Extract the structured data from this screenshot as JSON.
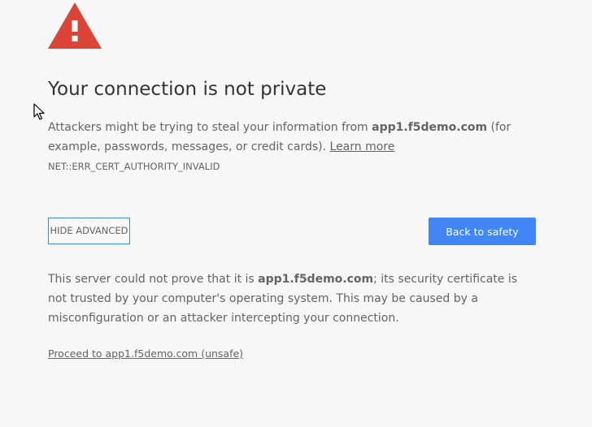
{
  "interstitial": {
    "title": "Your connection is not private",
    "main_prefix": "Attackers might be trying to steal your information from ",
    "domain": "app1.f5demo.com",
    "main_suffix": " (for example, passwords, messages, or credit cards). ",
    "learn_more": "Learn more",
    "error_code": "NET::ERR_CERT_AUTHORITY_INVALID",
    "hide_advanced_label": "HIDE ADVANCED",
    "back_to_safety_label": "Back to safety",
    "details_prefix": "This server could not prove that it is ",
    "details_domain": "app1.f5demo.com",
    "details_suffix": "; its security certificate is not trusted by your computer's operating system. This may be caused by a misconfiguration or an attacker intercepting your connection.",
    "proceed_link": "Proceed to app1.f5demo.com (unsafe)"
  },
  "icons": {
    "warning": "warning-triangle-icon",
    "cursor": "mouse-pointer-icon"
  },
  "colors": {
    "background": "#f7f7f7",
    "warning_red": "#db4437",
    "primary_blue": "#4285f4",
    "text": "#646464",
    "title": "#333333"
  }
}
